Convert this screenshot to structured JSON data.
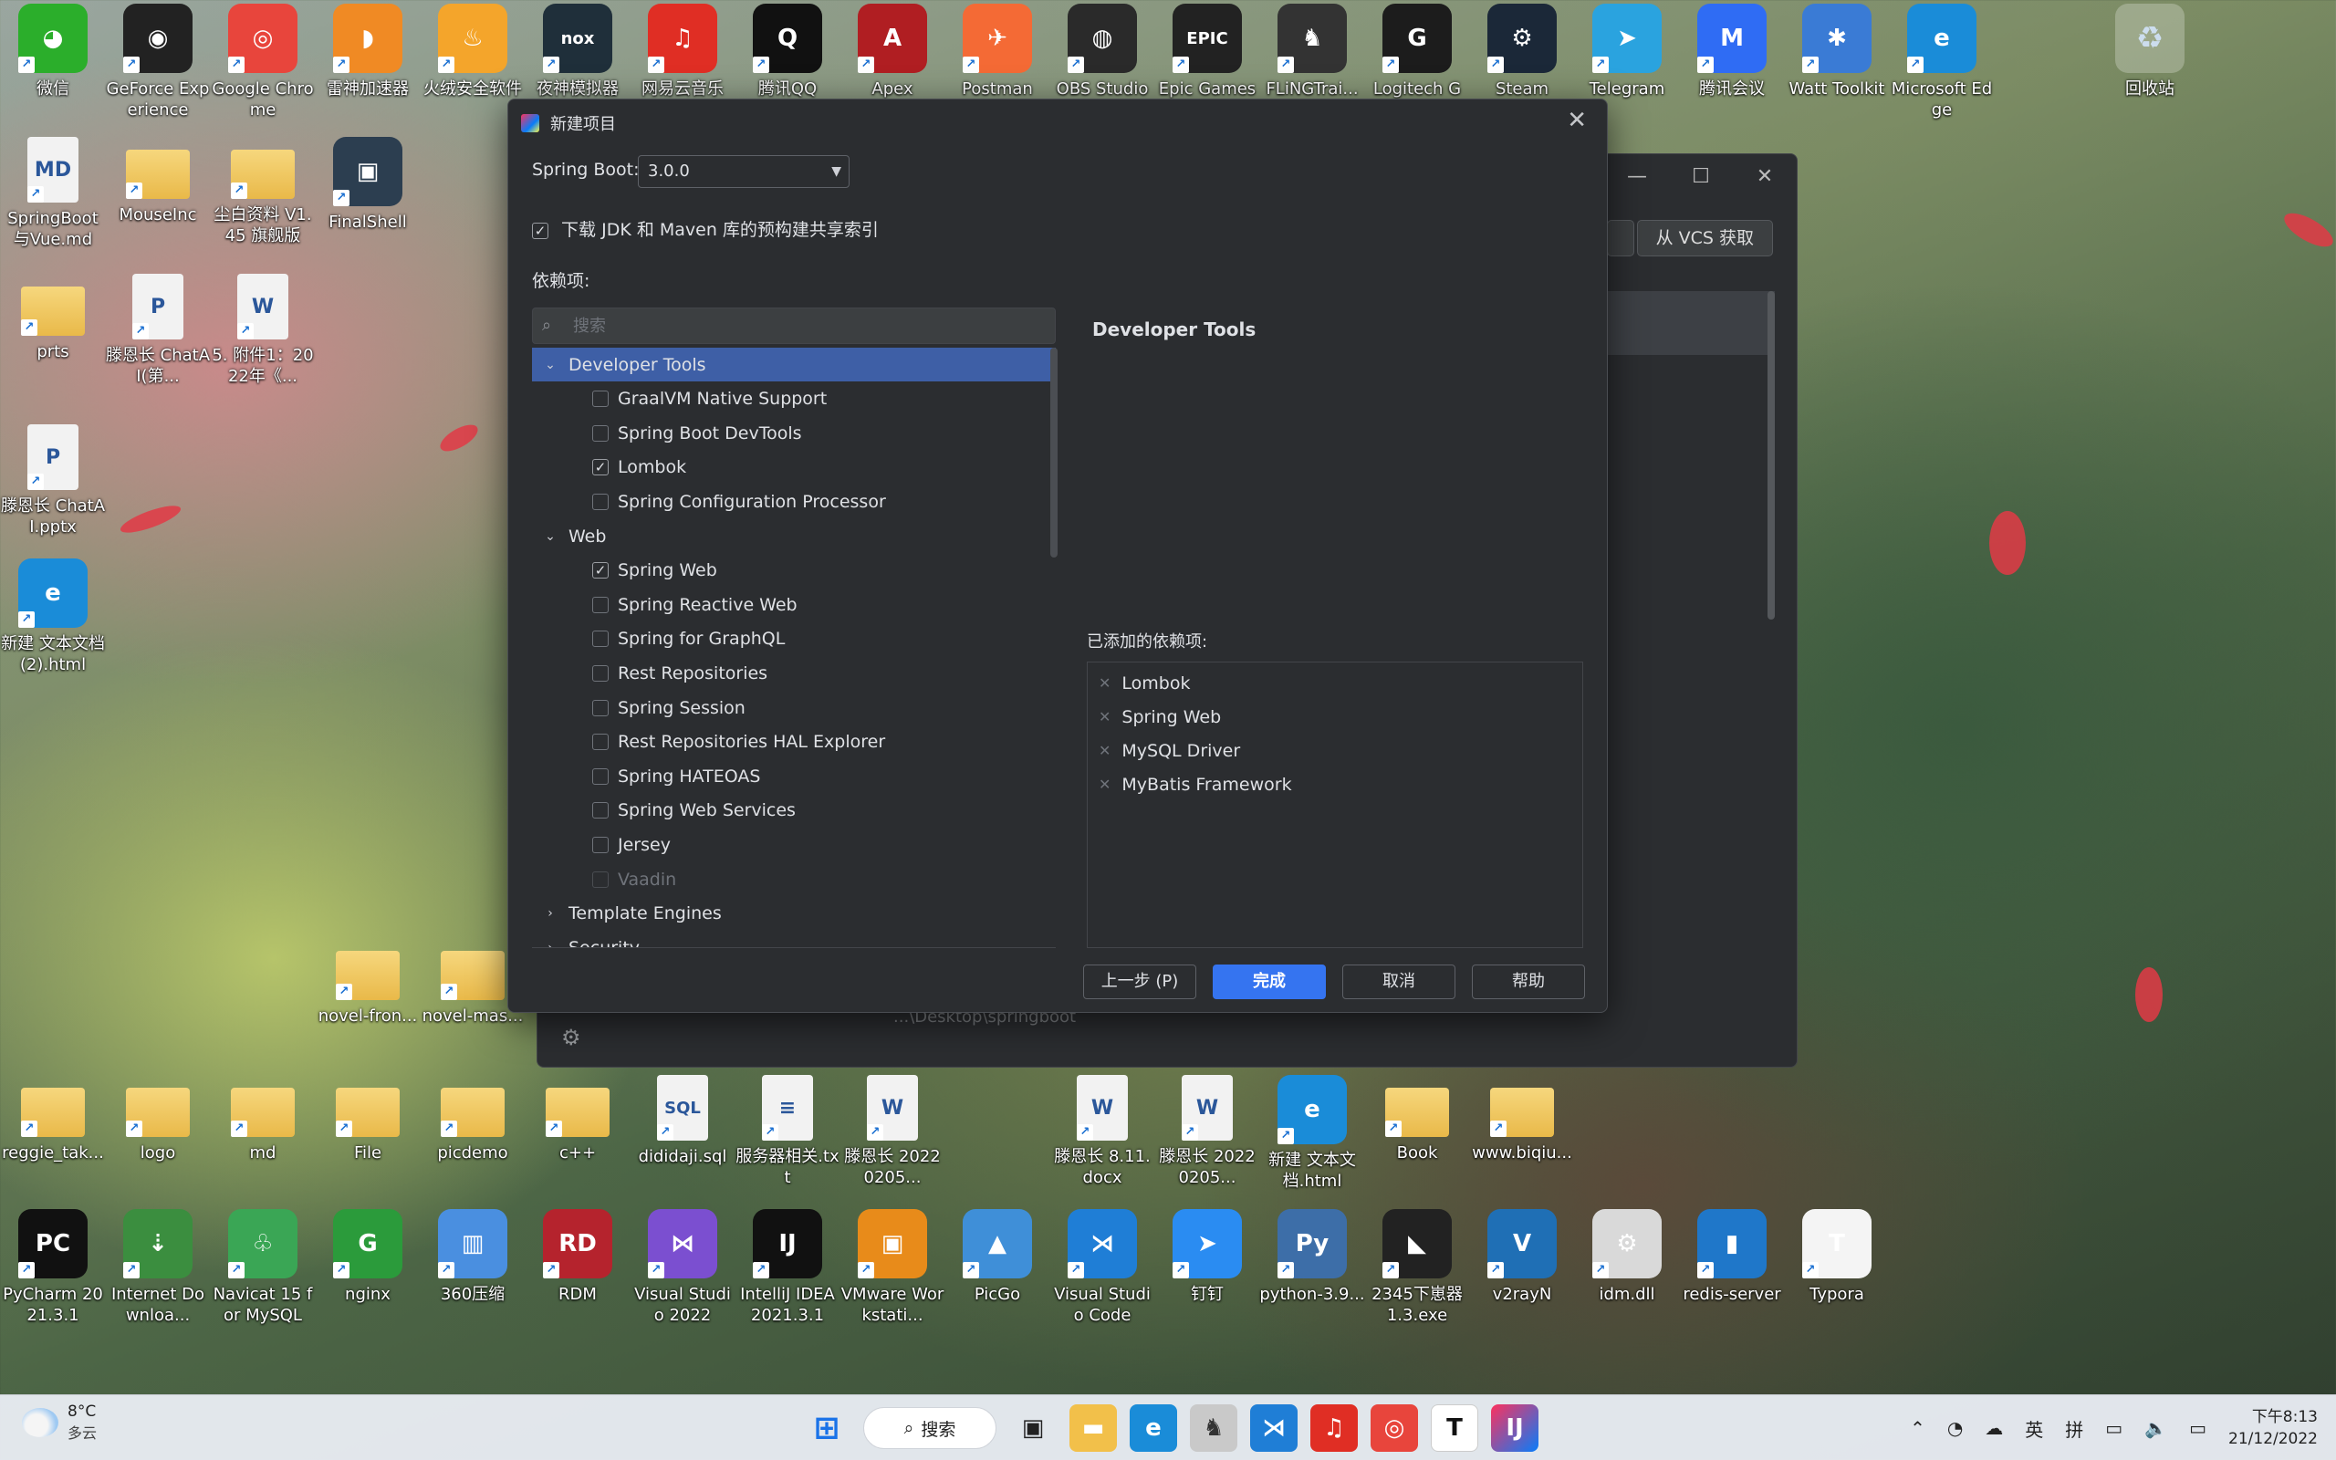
{
  "desktop": {
    "top_row": [
      {
        "label": "微信",
        "icon": "wechat-icon",
        "color": "#2bae2b",
        "glyph": "◕"
      },
      {
        "label": "GeForce Experience",
        "icon": "nvidia-icon",
        "color": "#222222",
        "glyph": "◉"
      },
      {
        "label": "Google Chrome",
        "icon": "chrome-icon",
        "color": "#e8453c",
        "glyph": "◎"
      },
      {
        "label": "雷神加速器",
        "icon": "leishen-icon",
        "color": "#f08a24",
        "glyph": "◗"
      },
      {
        "label": "火绒安全软件",
        "icon": "huorong-icon",
        "color": "#f4a52b",
        "glyph": "♨"
      },
      {
        "label": "夜神模拟器",
        "icon": "nox-icon",
        "color": "#1f2f3a",
        "glyph": "nox"
      },
      {
        "label": "网易云音乐",
        "icon": "netease-music-icon",
        "color": "#e02e24",
        "glyph": "♫"
      },
      {
        "label": "腾讯QQ",
        "icon": "qq-icon",
        "color": "#111111",
        "glyph": "Q"
      },
      {
        "label": "Apex",
        "icon": "apex-icon",
        "color": "#b01e22",
        "glyph": "A"
      },
      {
        "label": "Postman",
        "icon": "postman-icon",
        "color": "#f46a35",
        "glyph": "✈"
      },
      {
        "label": "OBS Studio",
        "icon": "obs-icon",
        "color": "#2a2a2a",
        "glyph": "◍"
      },
      {
        "label": "Epic Games",
        "icon": "epic-icon",
        "color": "#222222",
        "glyph": "EPIC"
      },
      {
        "label": "FLiNGTrai...",
        "icon": "fling-icon",
        "color": "#333333",
        "glyph": "♞"
      },
      {
        "label": "Logitech G",
        "icon": "logitech-icon",
        "color": "#1c1c1c",
        "glyph": "G"
      },
      {
        "label": "Steam",
        "icon": "steam-icon",
        "color": "#1b2838",
        "glyph": "⚙"
      },
      {
        "label": "Telegram",
        "icon": "telegram-icon",
        "color": "#2aa3df",
        "glyph": "➤"
      },
      {
        "label": "腾讯会议",
        "icon": "tencent-meeting-icon",
        "color": "#2f6cf4",
        "glyph": "M"
      },
      {
        "label": "Watt Toolkit",
        "icon": "watt-toolkit-icon",
        "color": "#3a7bd5",
        "glyph": "✱"
      },
      {
        "label": "Microsoft Edge",
        "icon": "edge-icon",
        "color": "#1a8cd8",
        "glyph": "e"
      }
    ],
    "recycle_bin": "回收站",
    "left_column": [
      {
        "label": "SpringBoot与Vue.md",
        "icon": "markdown-file-icon",
        "kind": "doc",
        "glyph": "MD"
      },
      {
        "label": "MouseInc",
        "icon": "folder-icon",
        "kind": "folder"
      },
      {
        "label": "尘白资料 V1.45 旗舰版",
        "icon": "folder-icon",
        "kind": "folder"
      },
      {
        "label": "FinalShell",
        "icon": "finalshell-icon",
        "kind": "app",
        "color": "#2c3e50",
        "glyph": "▣"
      },
      {
        "label": "prts",
        "icon": "folder-icon",
        "kind": "folder"
      },
      {
        "label": "滕恩长 ChatAI(第...",
        "icon": "pptx-icon",
        "kind": "doc",
        "glyph": "P"
      },
      {
        "label": "5. 附件1：2022年《...",
        "icon": "word-doc-icon",
        "kind": "doc",
        "glyph": "W"
      },
      {
        "label": "滕恩长 ChatAI.pptx",
        "icon": "pptx-icon",
        "kind": "doc",
        "glyph": "P"
      },
      {
        "label": "新建 文本文档 (2).html",
        "icon": "edge-html-icon",
        "kind": "app",
        "color": "#1a8cd8",
        "glyph": "e"
      },
      {
        "label": "novel-fron...",
        "icon": "folder-icon",
        "kind": "folder"
      },
      {
        "label": "novel-mas...",
        "icon": "folder-icon",
        "kind": "folder"
      }
    ],
    "row_mid": [
      {
        "label": "reggie_tak...",
        "icon": "folder-icon",
        "kind": "folder"
      },
      {
        "label": "logo",
        "icon": "folder-icon",
        "kind": "folder"
      },
      {
        "label": "md",
        "icon": "folder-icon",
        "kind": "folder"
      },
      {
        "label": "File",
        "icon": "folder-icon",
        "kind": "folder"
      },
      {
        "label": "picdemo",
        "icon": "folder-icon",
        "kind": "folder"
      },
      {
        "label": "c++",
        "icon": "folder-icon",
        "kind": "folder"
      },
      {
        "label": "dididaji.sql",
        "icon": "sql-file-icon",
        "kind": "doc",
        "glyph": "SQL"
      },
      {
        "label": "服务器相关.txt",
        "icon": "text-file-icon",
        "kind": "doc",
        "glyph": "≡"
      },
      {
        "label": "滕恩长 20220205...",
        "icon": "word-doc-icon",
        "kind": "doc",
        "glyph": "W"
      },
      {
        "label": "",
        "icon": "",
        "kind": "gap"
      },
      {
        "label": "滕恩长 8.11.docx",
        "icon": "word-doc-icon",
        "kind": "doc",
        "glyph": "W"
      },
      {
        "label": "滕恩长 20220205...",
        "icon": "word-doc-icon",
        "kind": "doc",
        "glyph": "W"
      },
      {
        "label": "新建 文本文档.html",
        "icon": "edge-html-icon",
        "kind": "app",
        "color": "#1a8cd8",
        "glyph": "e"
      },
      {
        "label": "Book",
        "icon": "folder-icon",
        "kind": "folder"
      },
      {
        "label": "www.biqiu...",
        "icon": "folder-icon",
        "kind": "folder"
      }
    ],
    "row_bottom": [
      {
        "label": "PyCharm 2021.3.1",
        "icon": "pycharm-icon",
        "color": "#111111",
        "glyph": "PC"
      },
      {
        "label": "Internet Downloa...",
        "icon": "idm-icon",
        "color": "#3b8e3f",
        "glyph": "⇣"
      },
      {
        "label": "Navicat 15 for MySQL",
        "icon": "navicat-icon",
        "color": "#3aa655",
        "glyph": "♧"
      },
      {
        "label": "nginx",
        "icon": "nginx-icon",
        "color": "#2b9b3b",
        "glyph": "G"
      },
      {
        "label": "360压缩",
        "icon": "360zip-icon",
        "color": "#4a8fe0",
        "glyph": "▥"
      },
      {
        "label": "RDM",
        "icon": "rdm-icon",
        "color": "#b5232d",
        "glyph": "RD"
      },
      {
        "label": "Visual Studio 2022",
        "icon": "visual-studio-icon",
        "color": "#7b4fd0",
        "glyph": "⋈"
      },
      {
        "label": "IntelliJ IDEA 2021.3.1",
        "icon": "intellij-icon",
        "color": "#111111",
        "glyph": "IJ"
      },
      {
        "label": "VMware Workstati...",
        "icon": "vmware-icon",
        "color": "#e88b1a",
        "glyph": "▣"
      },
      {
        "label": "PicGo",
        "icon": "picgo-icon",
        "color": "#3f8fd8",
        "glyph": "▲"
      },
      {
        "label": "Visual Studio Code",
        "icon": "vscode-icon",
        "color": "#1f7ed6",
        "glyph": "⋊"
      },
      {
        "label": "钉钉",
        "icon": "dingtalk-icon",
        "color": "#2a8cf2",
        "glyph": "➤"
      },
      {
        "label": "python-3.9...",
        "icon": "python-icon",
        "color": "#3d6ea8",
        "glyph": "Py"
      },
      {
        "label": "2345下崽器 1.3.exe",
        "icon": "penguin-icon",
        "color": "#222222",
        "glyph": "◣"
      },
      {
        "label": "v2rayN",
        "icon": "v2rayn-icon",
        "color": "#1f6fb5",
        "glyph": "V"
      },
      {
        "label": "idm.dll",
        "icon": "dll-file-icon",
        "color": "#d9d9d9",
        "glyph": "⚙"
      },
      {
        "label": "redis-server",
        "icon": "redis-icon",
        "color": "#1f77c9",
        "glyph": "▮"
      },
      {
        "label": "Typora",
        "icon": "typora-icon",
        "color": "#f4f4f4",
        "glyph": "T"
      }
    ]
  },
  "bg_window": {
    "vcs_button": "从 VCS 获取",
    "path_text": "...\\Desktop\\springboot"
  },
  "dialog": {
    "title": "新建项目",
    "spring_boot_label": "Spring Boot:",
    "spring_boot_version": "3.0.0",
    "download_index_label": "下载 JDK 和 Maven 库的预构建共享索引",
    "dependencies_label": "依赖项:",
    "search_placeholder": "搜索",
    "tree": [
      {
        "type": "group",
        "label": "Developer Tools",
        "expanded": true,
        "selected": true
      },
      {
        "type": "item",
        "label": "GraalVM Native Support",
        "checked": false
      },
      {
        "type": "item",
        "label": "Spring Boot DevTools",
        "checked": false
      },
      {
        "type": "item",
        "label": "Lombok",
        "checked": true
      },
      {
        "type": "item",
        "label": "Spring Configuration Processor",
        "checked": false
      },
      {
        "type": "group",
        "label": "Web",
        "expanded": true
      },
      {
        "type": "item",
        "label": "Spring Web",
        "checked": true
      },
      {
        "type": "item",
        "label": "Spring Reactive Web",
        "checked": false
      },
      {
        "type": "item",
        "label": "Spring for GraphQL",
        "checked": false
      },
      {
        "type": "item",
        "label": "Rest Repositories",
        "checked": false
      },
      {
        "type": "item",
        "label": "Spring Session",
        "checked": false
      },
      {
        "type": "item",
        "label": "Rest Repositories HAL Explorer",
        "checked": false
      },
      {
        "type": "item",
        "label": "Spring HATEOAS",
        "checked": false
      },
      {
        "type": "item",
        "label": "Spring Web Services",
        "checked": false
      },
      {
        "type": "item",
        "label": "Jersey",
        "checked": false
      },
      {
        "type": "item",
        "label": "Vaadin",
        "checked": false,
        "disabled": true
      },
      {
        "type": "group",
        "label": "Template Engines",
        "expanded": false
      },
      {
        "type": "group",
        "label": "Security",
        "expanded": false
      }
    ],
    "detail_title": "Developer Tools",
    "added_label": "已添加的依赖项:",
    "added": [
      "Lombok",
      "Spring Web",
      "MySQL Driver",
      "MyBatis Framework"
    ],
    "buttons": {
      "prev": "上一步 (P)",
      "finish": "完成",
      "cancel": "取消",
      "help": "帮助"
    }
  },
  "taskbar": {
    "temperature": "8°C",
    "weather": "多云",
    "search_label": "搜索",
    "ime_lang": "英",
    "ime_mode": "拼",
    "time": "下午8:13",
    "date": "21/12/2022"
  }
}
